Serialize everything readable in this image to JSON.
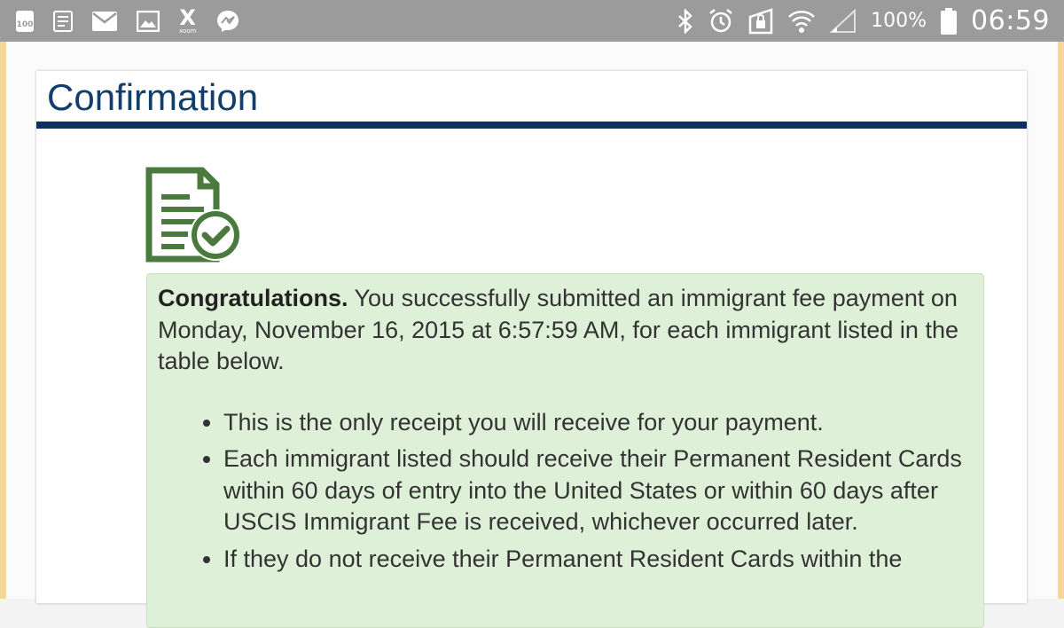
{
  "status_bar": {
    "notification_badge": "100",
    "x_app_caption": "xoom",
    "battery_percent": "100%",
    "clock": "06:59",
    "icons": [
      "badge-100-icon",
      "document-icon",
      "mail-icon",
      "image-icon",
      "xoom-icon",
      "messenger-icon",
      "bluetooth-icon",
      "alarm-icon",
      "lock-icon",
      "wifi-icon",
      "signal-icon",
      "battery-icon"
    ],
    "color": "#9b9b9b"
  },
  "page": {
    "title": "Confirmation",
    "title_color": "#123e6e",
    "rule_color": "#0d305c",
    "icon": "document-check-icon",
    "icon_color": "#4a7a3e"
  },
  "alert": {
    "lead": "Congratulations.",
    "message": " You successfully submitted an immigrant fee payment on Monday, November 16, 2015 at 6:57:59 AM, for each immigrant listed in the table below.",
    "background": "#dff0d8",
    "bullets": [
      "This is the only receipt you will receive for your payment.",
      "Each immigrant listed should receive their Permanent Resident Cards within 60 days of entry into the United States or within 60 days after USCIS Immigrant Fee is received, whichever occurred later.",
      "If they do not receive their Permanent Resident Cards within the"
    ]
  }
}
